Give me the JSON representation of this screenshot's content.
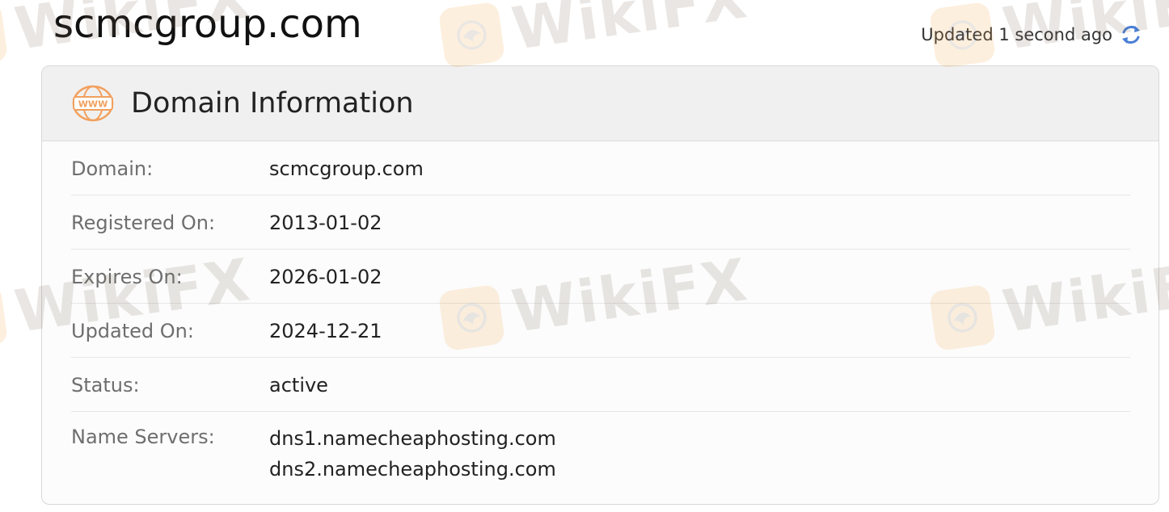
{
  "page": {
    "title": "scmcgroup.com",
    "updated_text": "Updated 1 second ago"
  },
  "colors": {
    "accent_orange": "#f2a05e",
    "refresh_blue": "#4a7fd4",
    "watermark": "#f4a23a"
  },
  "icons": {
    "header": "www-globe-icon",
    "refresh": "refresh-icon",
    "watermark": "wikifx-eagle-logo"
  },
  "watermark": {
    "text": "WikiFX"
  },
  "card": {
    "title": "Domain Information",
    "rows": [
      {
        "label": "Domain:",
        "value": "scmcgroup.com"
      },
      {
        "label": "Registered On:",
        "value": "2013-01-02"
      },
      {
        "label": "Expires On:",
        "value": "2026-01-02"
      },
      {
        "label": "Updated On:",
        "value": "2024-12-21"
      },
      {
        "label": "Status:",
        "value": "active"
      },
      {
        "label": "Name Servers:",
        "values": [
          "dns1.namecheaphosting.com",
          "dns2.namecheaphosting.com"
        ]
      }
    ]
  }
}
